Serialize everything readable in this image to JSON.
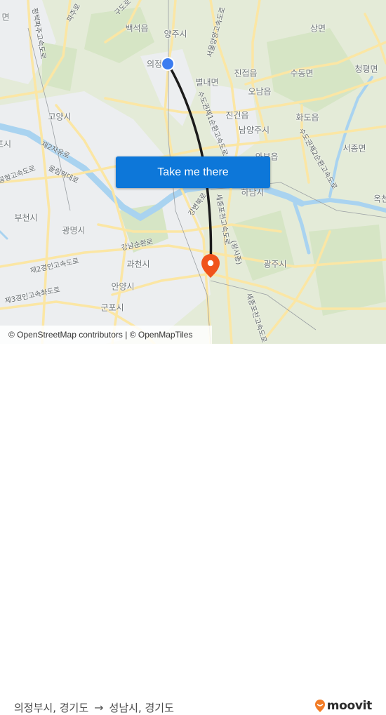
{
  "map": {
    "places": [
      {
        "name": "백석읍",
        "pos": "p1"
      },
      {
        "name": "양주시",
        "pos": "p2"
      },
      {
        "name": "의정",
        "pos": "p3"
      },
      {
        "name": "상면",
        "pos": "p4"
      },
      {
        "name": "진접읍",
        "pos": "p5"
      },
      {
        "name": "별내면",
        "pos": "p6"
      },
      {
        "name": "오남읍",
        "pos": "p7"
      },
      {
        "name": "수동면",
        "pos": "p8"
      },
      {
        "name": "청평면",
        "pos": "p9"
      },
      {
        "name": "진건읍",
        "pos": "p10"
      },
      {
        "name": "화도읍",
        "pos": "p11"
      },
      {
        "name": "남양주시",
        "pos": "p12"
      },
      {
        "name": "고양시",
        "pos": "p13"
      },
      {
        "name": "서종면",
        "pos": "p14"
      },
      {
        "name": "와부읍",
        "pos": "p15"
      },
      {
        "name": "하남시",
        "pos": "p16"
      },
      {
        "name": "부천시",
        "pos": "p17"
      },
      {
        "name": "광명시",
        "pos": "p18"
      },
      {
        "name": "과천시",
        "pos": "p19"
      },
      {
        "name": "광주시",
        "pos": "p20"
      },
      {
        "name": "안양시",
        "pos": "p21"
      },
      {
        "name": "군포시",
        "pos": "p22"
      },
      {
        "name": "옥천",
        "pos": "p23"
      },
      {
        "name": "포시",
        "pos": "p24"
      },
      {
        "name": "면",
        "pos": "p25"
      }
    ],
    "roads": [
      {
        "name": "평택파주고속도로",
        "pos": "r1"
      },
      {
        "name": "파주로",
        "pos": "r2"
      },
      {
        "name": "구도로",
        "pos": "r3"
      },
      {
        "name": "서울양양고속도로",
        "pos": "r4"
      },
      {
        "name": "수도권제1순환고속도로",
        "pos": "r5"
      },
      {
        "name": "수도권제2순환고속도로",
        "pos": "r6"
      },
      {
        "name": "제2자유로",
        "pos": "r7"
      },
      {
        "name": "올림픽대로",
        "pos": "r8"
      },
      {
        "name": "공항고속도로",
        "pos": "r9"
      },
      {
        "name": "강변북로",
        "pos": "r10"
      },
      {
        "name": "세종포천고속도로",
        "pos": "r11"
      },
      {
        "name": "(광시종)",
        "pos": "r12"
      },
      {
        "name": "강남순환로",
        "pos": "r13"
      },
      {
        "name": "제2경인고속도로",
        "pos": "r14"
      },
      {
        "name": "제3경인고속화도로",
        "pos": "r15"
      },
      {
        "name": "세종포천고속도로",
        "pos": "r16"
      }
    ],
    "origin_marker": {
      "label": "origin",
      "color": "#3b7cf0"
    },
    "destination_marker": {
      "label": "destination",
      "color": "#f0531c"
    },
    "route_line_color": "#1b1b1b"
  },
  "cta": {
    "label": "Take me there",
    "color": "#0d77d9"
  },
  "attribution": {
    "text": "© OpenStreetMap contributors | © OpenMapTiles"
  },
  "footer": {
    "origin": "의정부시, 경기도",
    "arrow": "→",
    "destination": "성남시, 경기도",
    "brand": "moovit",
    "brand_color": "#f27c26"
  }
}
